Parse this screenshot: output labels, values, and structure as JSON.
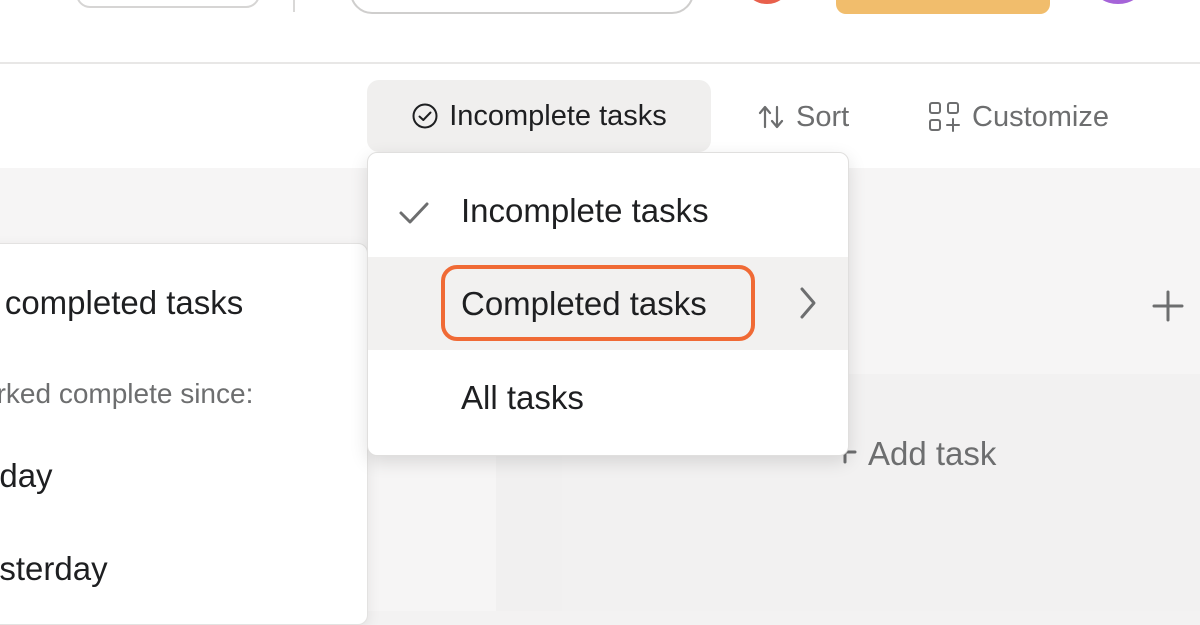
{
  "toolbar": {
    "filter_label": "Incomplete tasks",
    "sort_label": "Sort",
    "customize_label": "Customize"
  },
  "dropdown": {
    "items": [
      {
        "label": "Incomplete tasks",
        "checked": true
      },
      {
        "label": "Completed tasks",
        "has_submenu": true,
        "highlighted": true
      },
      {
        "label": "All tasks"
      }
    ]
  },
  "submenu": {
    "all_completed": "ll completed tasks",
    "section_heading": "arked complete since:",
    "options": [
      "oday",
      "esterday"
    ]
  },
  "board": {
    "add_task_label": "Add task"
  },
  "colors": {
    "highlight": "#f06a35",
    "cta": "#f1bd6c",
    "avatar_red": "#e8604c",
    "avatar_purple": "#a563d8"
  },
  "icons": {
    "filter": "check-circle-icon",
    "sort": "sort-arrows-icon",
    "customize": "customize-grid-icon",
    "check": "check-icon",
    "chevron": "chevron-right-icon",
    "plus": "plus-icon"
  }
}
